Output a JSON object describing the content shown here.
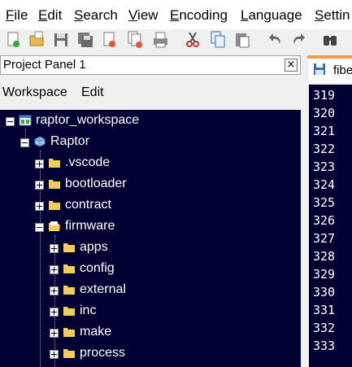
{
  "menu": {
    "items": [
      "File",
      "Edit",
      "Search",
      "View",
      "Encoding",
      "Language",
      "Settin"
    ]
  },
  "toolbar": {
    "icons": [
      "new-file-icon",
      "open-folder-icon",
      "save-icon",
      "save-all-icon",
      "close-icon",
      "close-all-icon",
      "print-icon",
      "cut-icon",
      "copy-icon",
      "paste-icon",
      "undo-icon",
      "redo-icon",
      "find-icon"
    ]
  },
  "project_panel": {
    "title": "Project Panel 1",
    "close_glyph": "×",
    "menu": [
      "Workspace",
      "Edit"
    ],
    "tree": [
      {
        "label": "raptor_workspace",
        "level": 0,
        "kind": "workspace",
        "expanded": true
      },
      {
        "label": "Raptor",
        "level": 1,
        "kind": "project",
        "expanded": true
      },
      {
        "label": ".vscode",
        "level": 2,
        "kind": "folder",
        "expanded": false
      },
      {
        "label": "bootloader",
        "level": 2,
        "kind": "folder",
        "expanded": false
      },
      {
        "label": "contract",
        "level": 2,
        "kind": "folder",
        "expanded": false
      },
      {
        "label": "firmware",
        "level": 2,
        "kind": "folder-open",
        "expanded": true
      },
      {
        "label": "apps",
        "level": 3,
        "kind": "folder",
        "expanded": false
      },
      {
        "label": "config",
        "level": 3,
        "kind": "folder",
        "expanded": false
      },
      {
        "label": "external",
        "level": 3,
        "kind": "folder",
        "expanded": false
      },
      {
        "label": "inc",
        "level": 3,
        "kind": "folder",
        "expanded": false
      },
      {
        "label": "make",
        "level": 3,
        "kind": "folder",
        "expanded": false
      },
      {
        "label": "process",
        "level": 3,
        "kind": "folder",
        "expanded": false
      }
    ]
  },
  "editor": {
    "tab_label": "fibe",
    "line_numbers": [
      "319",
      "320",
      "321",
      "322",
      "323",
      "324",
      "325",
      "326",
      "327",
      "328",
      "329",
      "330",
      "331",
      "332",
      "333"
    ]
  },
  "colors": {
    "tree_bg": "#000033",
    "tab_accent": "#f39c40",
    "folder": "#f2cc5c"
  }
}
